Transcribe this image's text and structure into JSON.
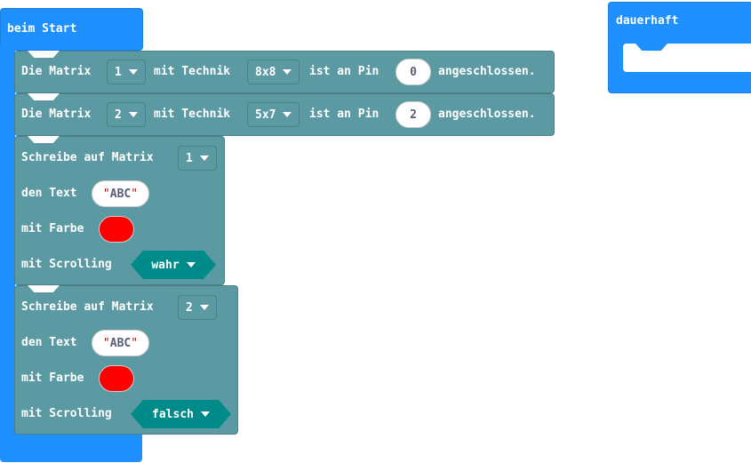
{
  "colors": {
    "event": "#1e90ff",
    "matrix": "#5c9aa3",
    "boolean": "#008b8b",
    "text_color": "#ff0000"
  },
  "start_block": {
    "label": "beim Start"
  },
  "forever_block": {
    "label": "dauerhaft"
  },
  "init_blocks": [
    {
      "prefix": "Die Matrix",
      "matrix": "1",
      "mid": "mit Technik",
      "type": "8x8",
      "pin_label": "ist an Pin",
      "pin": "0",
      "suffix": "angeschlossen."
    },
    {
      "prefix": "Die Matrix",
      "matrix": "2",
      "mid": "mit Technik",
      "type": "5x7",
      "pin_label": "ist an Pin",
      "pin": "2",
      "suffix": "angeschlossen."
    }
  ],
  "write_blocks": [
    {
      "label": "Schreibe auf Matrix",
      "matrix": "1",
      "text_label": "den Text",
      "text": "ABC",
      "color_label": "mit Farbe",
      "scroll_label": "mit Scrolling",
      "scroll": "wahr"
    },
    {
      "label": "Schreibe auf Matrix",
      "matrix": "2",
      "text_label": "den Text",
      "text": "ABC",
      "color_label": "mit Farbe",
      "scroll_label": "mit Scrolling",
      "scroll": "falsch"
    }
  ]
}
